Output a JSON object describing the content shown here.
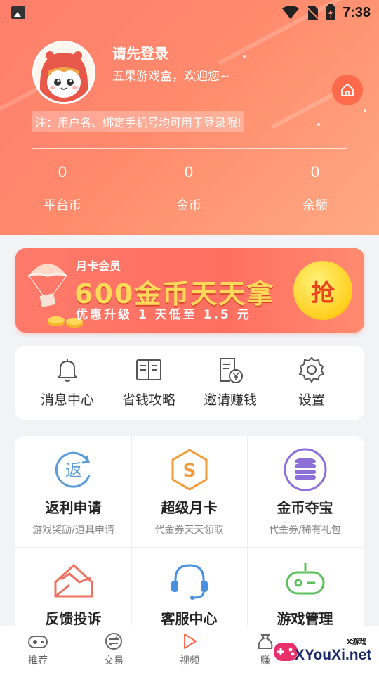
{
  "status_bar": {
    "time": "7:38"
  },
  "profile": {
    "login_prompt": "请先登录",
    "welcome": "五果游戏盒，欢迎您~",
    "note": "注：用户名、绑定手机号均可用于登录哦!"
  },
  "stats": [
    {
      "value": "0",
      "label": "平台币"
    },
    {
      "value": "0",
      "label": "金币"
    },
    {
      "value": "0",
      "label": "余额"
    }
  ],
  "banner": {
    "tag": "月卡会员",
    "headline": "600金币天天拿",
    "subline": "优惠升级 1 天低至 1.5 元",
    "button": "抢"
  },
  "quick_menu": [
    {
      "label": "消息中心",
      "icon": "bell-icon"
    },
    {
      "label": "省钱攻略",
      "icon": "book-icon"
    },
    {
      "label": "邀请赚钱",
      "icon": "yuan-receipt-icon"
    },
    {
      "label": "设置",
      "icon": "gear-icon"
    }
  ],
  "services": [
    {
      "title": "返利申请",
      "subtitle": "游戏奖励/道具申请",
      "icon": "rebate-icon",
      "color": "#5a9bd8"
    },
    {
      "title": "超级月卡",
      "subtitle": "代金券天天领取",
      "icon": "hexagon-s-icon",
      "color": "#f29b3b"
    },
    {
      "title": "金币夺宝",
      "subtitle": "代金券/稀有礼包",
      "icon": "coin-stack-icon",
      "color": "#8e6fd8"
    },
    {
      "title": "反馈投诉",
      "subtitle": "",
      "icon": "envelope-icon",
      "color": "#f07060"
    },
    {
      "title": "客服中心",
      "subtitle": "",
      "icon": "headset-icon",
      "color": "#4a90e2"
    },
    {
      "title": "游戏管理",
      "subtitle": "",
      "icon": "gamepad-icon",
      "color": "#5cc15c"
    }
  ],
  "bottom_nav": [
    {
      "label": "推荐",
      "icon": "gamepad-nav-icon"
    },
    {
      "label": "交易",
      "icon": "exchange-icon"
    },
    {
      "label": "视频",
      "icon": "play-icon"
    },
    {
      "label": "赚",
      "icon": "bag-icon"
    }
  ],
  "watermark": {
    "text": "XYouXi.net",
    "small": "X游戏"
  },
  "colors": {
    "header_start": "#ff7e6b",
    "header_end": "#ffa982",
    "accent": "#ff6a4d",
    "banner_gold": "#ffd95a"
  }
}
